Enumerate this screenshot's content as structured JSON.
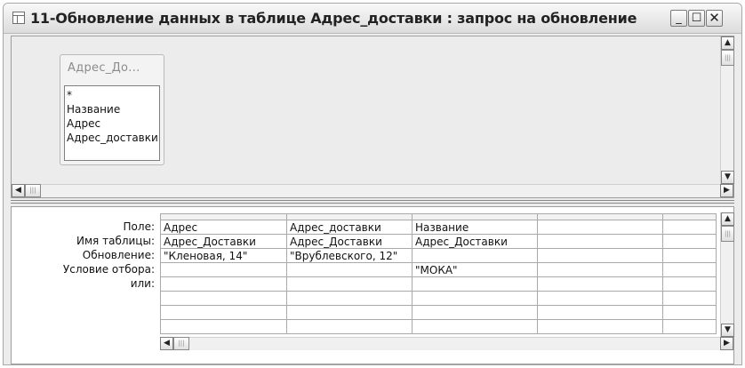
{
  "window": {
    "title": "11-Обновление данных в таблице Адрес_доставки : запрос на обновление",
    "controls": {
      "minimize": "_",
      "maximize": "☐",
      "close": "✕"
    }
  },
  "table_box": {
    "title": "Адрес_До...",
    "fields": [
      "*",
      "Название",
      "Адрес",
      "Адрес_доставки"
    ]
  },
  "grid": {
    "row_labels": [
      "Поле:",
      "Имя таблицы:",
      "Обновление:",
      "Условие отбора:",
      "или:"
    ],
    "columns": [
      {
        "field": "Адрес",
        "table": "Адрес_Доставки",
        "update": "\"Кленовая, 14\"",
        "criteria": "",
        "or": ""
      },
      {
        "field": "Адрес_доставки",
        "table": "Адрес_Доставки",
        "update": "\"Врублевского, 12\"",
        "criteria": "",
        "or": ""
      },
      {
        "field": "Название",
        "table": "Адрес_Доставки",
        "update": "",
        "criteria": "\"МОКА\"",
        "or": ""
      },
      {
        "field": "",
        "table": "",
        "update": "",
        "criteria": "",
        "or": ""
      },
      {
        "field": "",
        "table": "",
        "update": "",
        "criteria": "",
        "or": ""
      }
    ]
  },
  "icons": {
    "title": "query-icon",
    "scroll_up": "▲",
    "scroll_down": "▼",
    "scroll_left": "◀",
    "scroll_right": "▶",
    "grip": "|||"
  }
}
